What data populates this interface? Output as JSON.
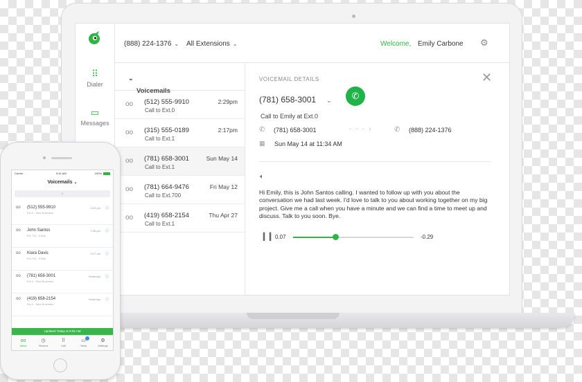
{
  "colors": {
    "accent": "#2db742",
    "call_button": "#1fb34a",
    "info": "#4a90d9"
  },
  "header": {
    "phone_number": "(888) 224-1376",
    "extensions": "All Extensions",
    "welcome": "Welcome,",
    "user_name": "Emily Carbone",
    "settings_icon": "gear-icon"
  },
  "sidebar": {
    "items": [
      {
        "label": "Dialer",
        "icon": "dialpad-icon"
      },
      {
        "label": "Messages",
        "icon": "chat-icon"
      }
    ]
  },
  "voicemails": {
    "title": "Voicemails",
    "items": [
      {
        "number": "(512) 555-9910",
        "sub": "Call to Ext.0",
        "time": "2:29pm"
      },
      {
        "number": "(315) 555-0189",
        "sub": "Call to Ext.1",
        "time": "2:17pm"
      },
      {
        "number": "(781) 658-3001",
        "sub": "Call to Ext.1",
        "time": "Sun May 14"
      },
      {
        "number": "(781) 664-9476",
        "sub": "Call to Ext.700",
        "time": "Fri May 12"
      },
      {
        "number": "(419) 658-2154",
        "sub": "Call to Ext.1",
        "time": "Thu Apr 27"
      }
    ]
  },
  "details": {
    "label": "VOICEMAIL DETAILS",
    "number": "(781) 658-3001",
    "call_to": "Call to Emily at Ext.0",
    "from": "(781) 658-3001",
    "to": "(888) 224-1376",
    "date": "Sun May 14 at 11:34 AM",
    "transcript": "Hi Emily, this is John Santos calling. I wanted to follow up with you about the conversation we had last week. I'd love to talk to you about working together on my big project. Give me a call when you have a minute and we can find a time to meet up and discuss. Talk to you soon. Bye.",
    "player": {
      "elapsed": "0.07",
      "remaining": "-0.29",
      "progress": 0.35
    }
  },
  "mobile": {
    "status": {
      "carrier": "Carrier",
      "time": "9:41 AM",
      "battery": "100%"
    },
    "title": "Voicemails",
    "items": [
      {
        "name": "(512) 555-9910",
        "sub": "Ext 0 - New Business",
        "time": "6:24 pm"
      },
      {
        "name": "John Santos",
        "sub": "Ext 701 - Emily",
        "time": "1:08 pm"
      },
      {
        "name": "Kiara Davis",
        "sub": "Ext 701 - Emily",
        "time": "9:47 am"
      },
      {
        "name": "(781) 658-3001",
        "sub": "Ext 0 - New Business",
        "time": "Yesterday"
      },
      {
        "name": "(419) 658-2154",
        "sub": "Ext 0 - New Business",
        "time": "Yesterday"
      }
    ],
    "banner": "Updated Today at 9:05 AM",
    "tabs": [
      {
        "label": "Inbox",
        "icon": "voicemail-icon"
      },
      {
        "label": "Recent",
        "icon": "clock-icon"
      },
      {
        "label": "Call",
        "icon": "dialpad-icon"
      },
      {
        "label": "Texts",
        "icon": "chat-icon"
      },
      {
        "label": "Settings",
        "icon": "gear-icon"
      }
    ]
  }
}
